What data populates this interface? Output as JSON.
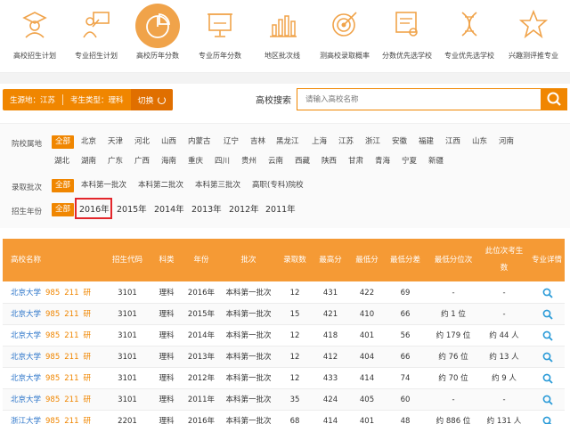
{
  "nav": {
    "items": [
      {
        "label": "高校招生计划",
        "icon": "scholar-person-icon"
      },
      {
        "label": "专业招生计划",
        "icon": "teacher-board-icon"
      },
      {
        "label": "高校历年分数",
        "icon": "pie-chart-icon",
        "active": true
      },
      {
        "label": "专业历年分数",
        "icon": "presentation-board-icon"
      },
      {
        "label": "地区批次线",
        "icon": "bar-chart-icon"
      },
      {
        "label": "测高校录取概率",
        "icon": "target-icon"
      },
      {
        "label": "分数优先选学校",
        "icon": "certificate-icon"
      },
      {
        "label": "专业优先选学校",
        "icon": "dna-icon"
      },
      {
        "label": "兴趣测评推专业",
        "icon": "star-icon"
      }
    ]
  },
  "filter_bar": {
    "source": "生源地：江苏",
    "student_type": "考生类型：理科",
    "switch_label": "切换"
  },
  "search": {
    "label": "高校搜索",
    "placeholder": "请输入高校名称"
  },
  "filters": {
    "location": {
      "label": "院校属地",
      "all": "全部",
      "row1": [
        "北京",
        "天津",
        "河北",
        "山西",
        "内蒙古",
        "辽宁",
        "吉林",
        "黑龙江",
        "上海",
        "江苏",
        "浙江",
        "安徽",
        "福建",
        "江西",
        "山东",
        "河南"
      ],
      "row2": [
        "湖北",
        "湖南",
        "广东",
        "广西",
        "海南",
        "重庆",
        "四川",
        "贵州",
        "云南",
        "西藏",
        "陕西",
        "甘肃",
        "青海",
        "宁夏",
        "新疆"
      ]
    },
    "batch": {
      "label": "录取批次",
      "all": "全部",
      "options": [
        "本科第一批次",
        "本科第二批次",
        "本科第三批次",
        "高职(专科)院校"
      ]
    },
    "year": {
      "label": "招生年份",
      "all": "全部",
      "options": [
        "2016年",
        "2015年",
        "2014年",
        "2013年",
        "2012年",
        "2011年"
      ]
    }
  },
  "table": {
    "headers": {
      "school": "高校名称",
      "code": "招生代码",
      "subject": "科类",
      "year": "年份",
      "batch": "批次",
      "admitted": "录取数",
      "max": "最高分",
      "min": "最低分",
      "min_diff": "最低分差",
      "min_rank": "最低分位次",
      "same_rank_line1": "此位次考生",
      "same_rank_line2": "数",
      "detail": "专业详情"
    },
    "rows": [
      {
        "school": "北京大学",
        "t1": "985",
        "t2": "211",
        "t3": "研",
        "code": "3101",
        "subject": "理科",
        "year": "2016年",
        "batch": "本科第一批次",
        "admitted": "12",
        "max": "431",
        "min": "422",
        "diff": "69",
        "rank": "-",
        "same": "-"
      },
      {
        "school": "北京大学",
        "t1": "985",
        "t2": "211",
        "t3": "研",
        "code": "3101",
        "subject": "理科",
        "year": "2015年",
        "batch": "本科第一批次",
        "admitted": "15",
        "max": "421",
        "min": "410",
        "diff": "66",
        "rank": "约 1 位",
        "same": "-"
      },
      {
        "school": "北京大学",
        "t1": "985",
        "t2": "211",
        "t3": "研",
        "code": "3101",
        "subject": "理科",
        "year": "2014年",
        "batch": "本科第一批次",
        "admitted": "12",
        "max": "418",
        "min": "401",
        "diff": "56",
        "rank": "约 179 位",
        "same": "约 44 人"
      },
      {
        "school": "北京大学",
        "t1": "985",
        "t2": "211",
        "t3": "研",
        "code": "3101",
        "subject": "理科",
        "year": "2013年",
        "batch": "本科第一批次",
        "admitted": "12",
        "max": "412",
        "min": "404",
        "diff": "66",
        "rank": "约 76 位",
        "same": "约 13 人"
      },
      {
        "school": "北京大学",
        "t1": "985",
        "t2": "211",
        "t3": "研",
        "code": "3101",
        "subject": "理科",
        "year": "2012年",
        "batch": "本科第一批次",
        "admitted": "12",
        "max": "433",
        "min": "414",
        "diff": "74",
        "rank": "约 70 位",
        "same": "约 9 人"
      },
      {
        "school": "北京大学",
        "t1": "985",
        "t2": "211",
        "t3": "研",
        "code": "3101",
        "subject": "理科",
        "year": "2011年",
        "batch": "本科第一批次",
        "admitted": "35",
        "max": "424",
        "min": "405",
        "diff": "60",
        "rank": "-",
        "same": "-"
      },
      {
        "school": "浙江大学",
        "t1": "985",
        "t2": "211",
        "t3": "研",
        "code": "2201",
        "subject": "理科",
        "year": "2016年",
        "batch": "本科第一批次",
        "admitted": "68",
        "max": "414",
        "min": "401",
        "diff": "48",
        "rank": "约 886 位",
        "same": "约 131 人"
      }
    ]
  },
  "colors": {
    "accent": "#f08600",
    "header_bg": "#f59a35",
    "link": "#2b74c9",
    "highlight": "#e3262b"
  }
}
